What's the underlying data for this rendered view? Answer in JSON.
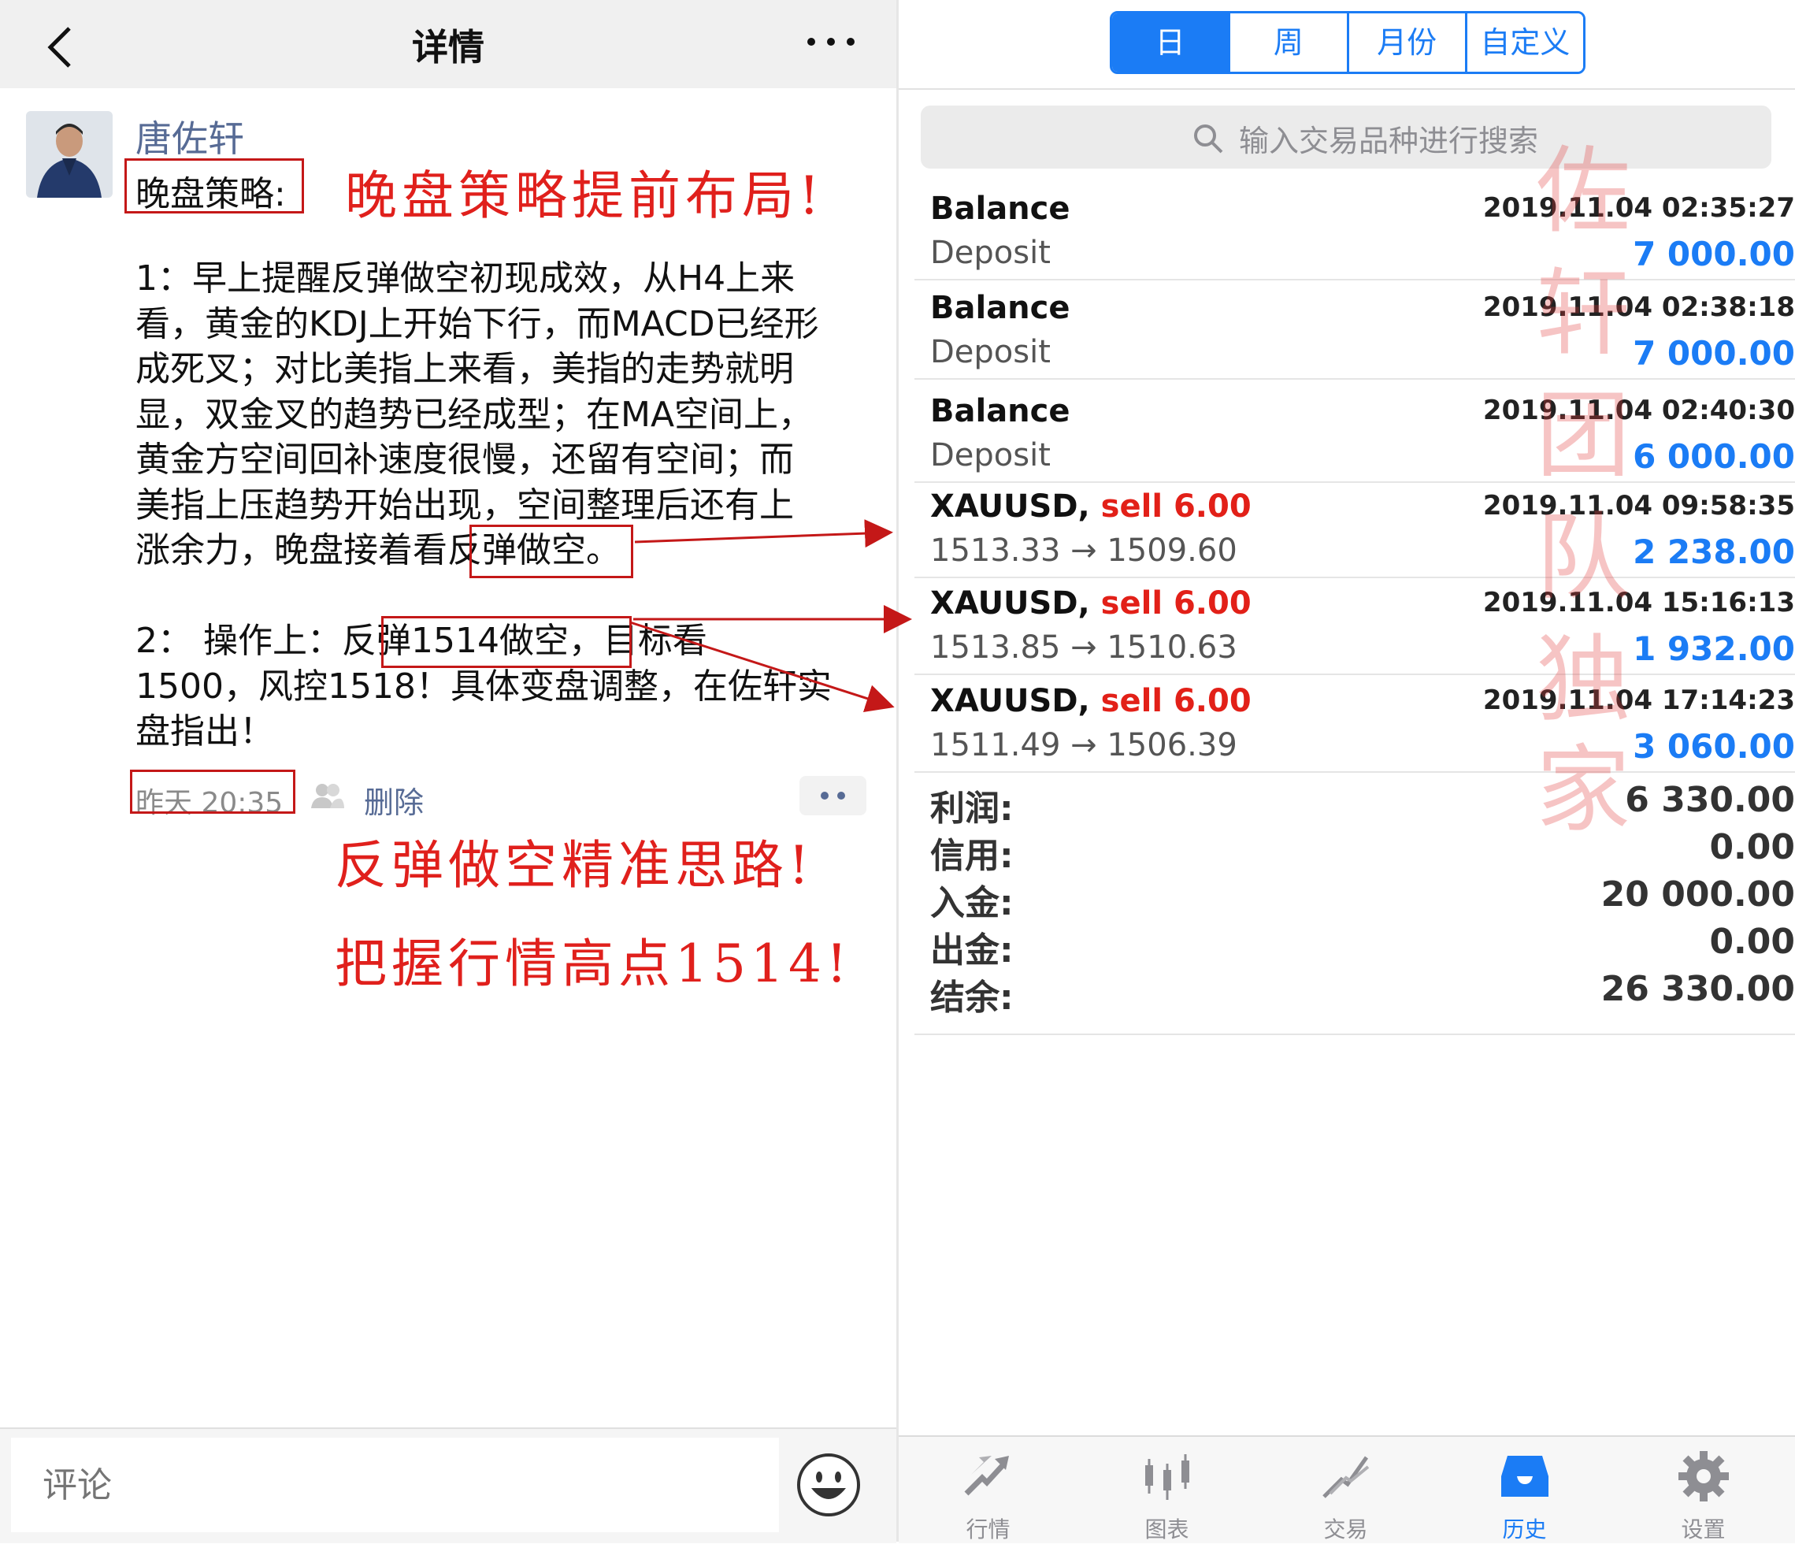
{
  "left": {
    "nav_title": "详情",
    "author": "唐佐轩",
    "strategy_title": "晚盘策略:",
    "note_top": "晚盘策略提前布局!",
    "post_lines": [
      " 1：早上提醒反弹做空初现成效，从H4上来",
      "看，黄金的KDJ上开始下行，而MACD已经形",
      "成死叉；对比美指上来看，美指的走势就明",
      "显，双金叉的趋势已经成型；在MA空间上，",
      "黄金方空间回补速度很慢，还留有空间；而",
      "美指上压趋势开始出现，空间整理后还有上",
      "涨余力，晚盘接着看反弹做空。",
      "",
      " 2： 操作上：反弹1514做空，目标看",
      "1500，风控1518！具体变盘调整，在佐轩实",
      "盘指出！"
    ],
    "post_time": "昨天 20:35",
    "delete_label": "删除",
    "note_middle": "反弹做空精准思路!",
    "note_bottom": "把握行情高点1514!",
    "comment_placeholder": "评论"
  },
  "right": {
    "segments": [
      {
        "label": "日",
        "active": true
      },
      {
        "label": "周",
        "active": false
      },
      {
        "label": "月份",
        "active": false
      },
      {
        "label": "自定义",
        "active": false
      }
    ],
    "search_placeholder": "输入交易品种进行搜索",
    "rows": [
      {
        "title": "Balance",
        "side": "",
        "sub": "Deposit",
        "time": "2019.11.04 02:35:27",
        "amount": "7 000.00"
      },
      {
        "title": "Balance",
        "side": "",
        "sub": "Deposit",
        "time": "2019.11.04 02:38:18",
        "amount": "7 000.00"
      },
      {
        "title": "Balance",
        "side": "",
        "sub": "Deposit",
        "time": "2019.11.04 02:40:30",
        "amount": "6 000.00"
      },
      {
        "title": "XAUUSD,",
        "side": "sell 6.00",
        "sub": "1513.33 → 1509.60",
        "time": "2019.11.04 09:58:35",
        "amount": "2 238.00"
      },
      {
        "title": "XAUUSD,",
        "side": "sell 6.00",
        "sub": "1513.85 → 1510.63",
        "time": "2019.11.04 15:16:13",
        "amount": "1 932.00"
      },
      {
        "title": "XAUUSD,",
        "side": "sell 6.00",
        "sub": "1511.49 → 1506.39",
        "time": "2019.11.04 17:14:23",
        "amount": "3 060.00"
      }
    ],
    "summary": [
      {
        "label": "利润:",
        "value": "6 330.00"
      },
      {
        "label": "信用:",
        "value": "0.00"
      },
      {
        "label": "入金:",
        "value": "20 000.00"
      },
      {
        "label": "出金:",
        "value": "0.00"
      },
      {
        "label": "结余:",
        "value": "26 330.00"
      }
    ],
    "watermark": [
      "佐",
      "轩",
      "团",
      "队",
      "独",
      "家"
    ],
    "tabs": [
      {
        "label": "行情",
        "icon": "quotes-icon",
        "active": false
      },
      {
        "label": "图表",
        "icon": "chart-icon",
        "active": false
      },
      {
        "label": "交易",
        "icon": "trade-icon",
        "active": false
      },
      {
        "label": "历史",
        "icon": "history-icon",
        "active": true
      },
      {
        "label": "设置",
        "icon": "settings-icon",
        "active": false
      }
    ]
  },
  "colors": {
    "accent": "#1b7cf5",
    "sell": "#e22018",
    "annotation": "#e0201c",
    "link": "#576b95"
  }
}
